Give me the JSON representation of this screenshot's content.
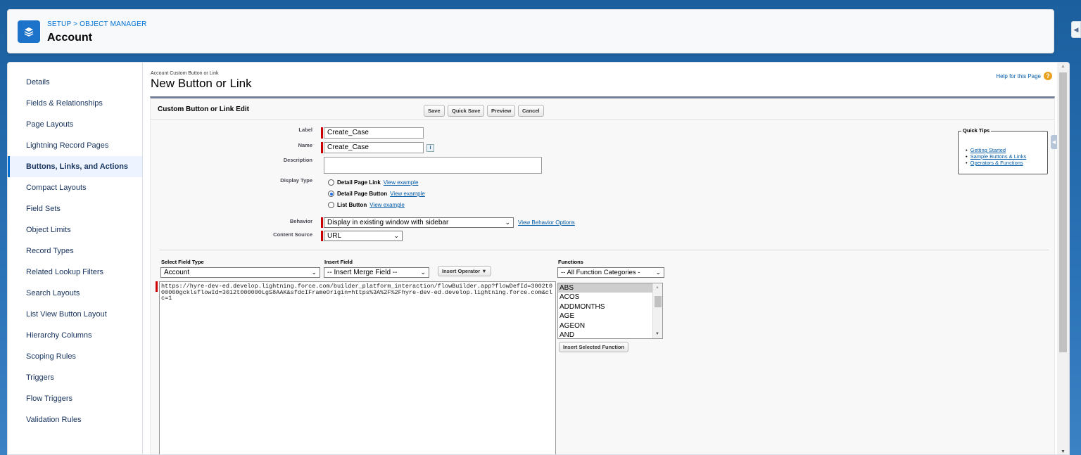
{
  "header": {
    "breadcrumb": "SETUP > OBJECT MANAGER",
    "title": "Account",
    "icon": "layers-icon"
  },
  "sidebar": {
    "items": [
      {
        "label": "Details"
      },
      {
        "label": "Fields & Relationships"
      },
      {
        "label": "Page Layouts"
      },
      {
        "label": "Lightning Record Pages"
      },
      {
        "label": "Buttons, Links, and Actions",
        "active": true
      },
      {
        "label": "Compact Layouts"
      },
      {
        "label": "Field Sets"
      },
      {
        "label": "Object Limits"
      },
      {
        "label": "Record Types"
      },
      {
        "label": "Related Lookup Filters"
      },
      {
        "label": "Search Layouts"
      },
      {
        "label": "List View Button Layout"
      },
      {
        "label": "Hierarchy Columns"
      },
      {
        "label": "Scoping Rules"
      },
      {
        "label": "Triggers"
      },
      {
        "label": "Flow Triggers"
      },
      {
        "label": "Validation Rules"
      }
    ]
  },
  "page": {
    "subtitle": "Account Custom Button or Link",
    "title": "New Button or Link",
    "help_link": "Help for this Page"
  },
  "edit": {
    "section_title": "Custom Button or Link Edit",
    "buttons": {
      "save": "Save",
      "quick_save": "Quick Save",
      "preview": "Preview",
      "cancel": "Cancel"
    },
    "fields": {
      "label_label": "Label",
      "label_value": "Create_Case",
      "name_label": "Name",
      "name_value": "Create_Case",
      "description_label": "Description",
      "description_value": "",
      "display_type_label": "Display Type",
      "behavior_label": "Behavior",
      "behavior_value": "Display in existing window with sidebar",
      "behavior_link": "View Behavior Options",
      "content_source_label": "Content Source",
      "content_source_value": "URL"
    },
    "display_options": [
      {
        "label": "Detail Page Link",
        "link": "View example",
        "selected": false
      },
      {
        "label": "Detail Page Button",
        "link": "View example",
        "selected": true
      },
      {
        "label": "List Button",
        "link": "View example",
        "selected": false
      }
    ],
    "quick_tips": {
      "title": "Quick Tips",
      "links": [
        "Getting Started",
        "Sample Buttons & Links",
        "Operators & Functions"
      ]
    }
  },
  "formula": {
    "select_field_type_label": "Select Field Type",
    "select_field_type_value": "Account",
    "insert_field_label": "Insert Field",
    "insert_field_value": "-- Insert Merge Field --",
    "insert_operator": "Insert Operator",
    "functions_label": "Functions",
    "functions_category": "-- All Function Categories -",
    "functions": [
      "ABS",
      "ACOS",
      "ADDMONTHS",
      "AGE",
      "AGEON",
      "AND"
    ],
    "insert_selected_function": "Insert Selected Function",
    "url": "https://hyre-dev-ed.develop.lightning.force.com/builder_platform_interaction/flowBuilder.app?flowDefId=3002t000000gcklsflowId=3012t000000LgS8AAK&sfdcIFrameOrigin=https%3A%2F%2Fhyre-dev-ed.develop.lightning.force.com&clc=1"
  },
  "colors": {
    "brand": "#1d73c9",
    "link": "#015ba7",
    "required": "#cc0000"
  }
}
